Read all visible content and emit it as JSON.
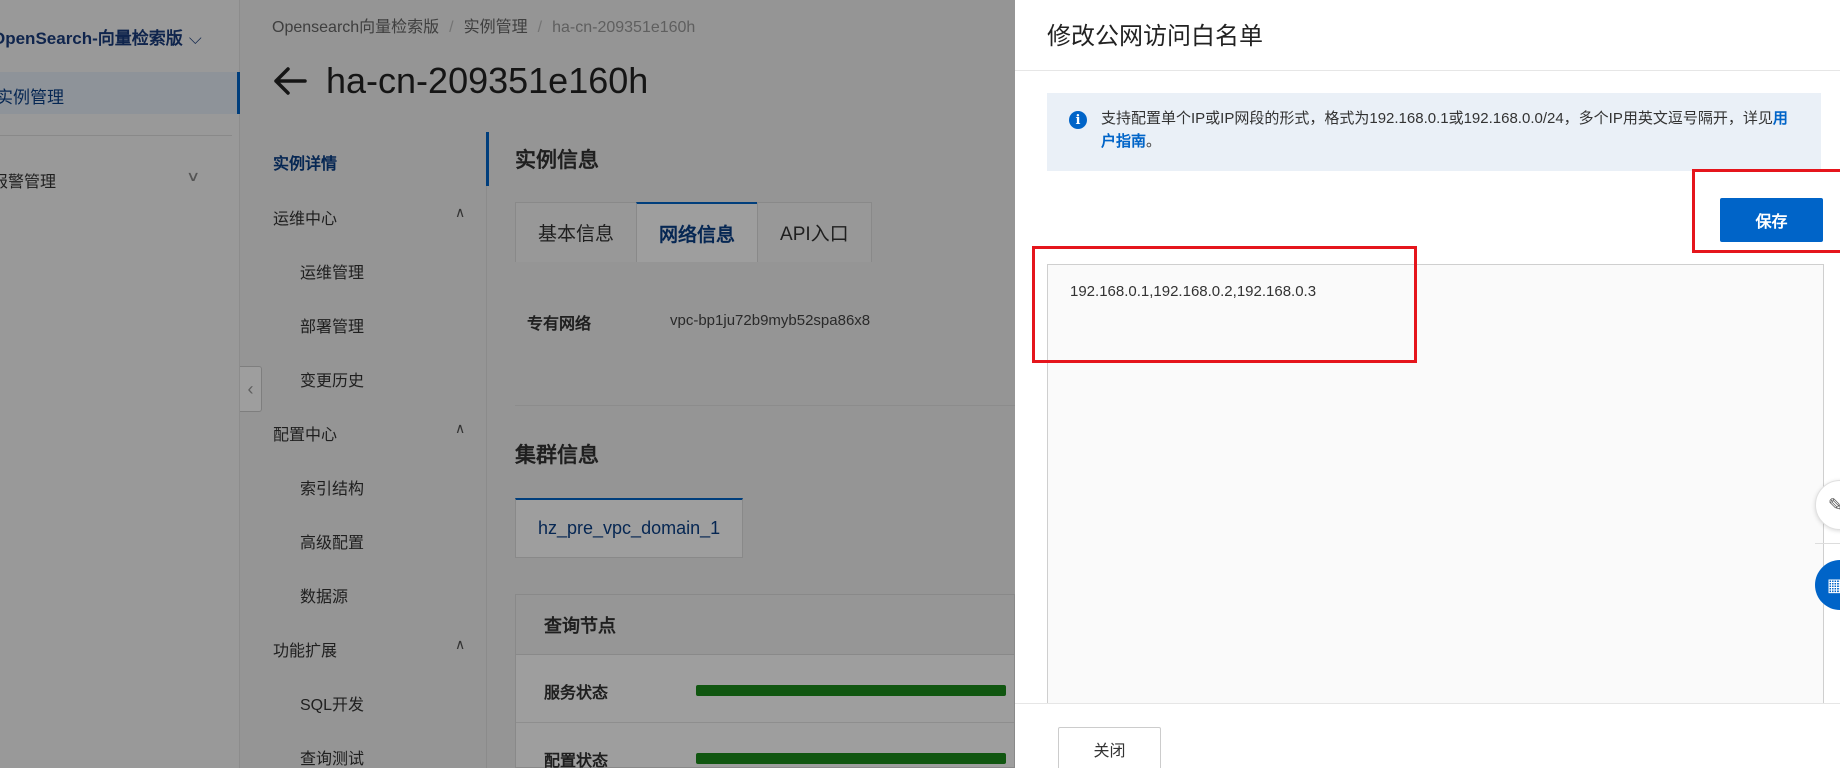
{
  "nav": {
    "product_title": "OpenSearch-向量检索版",
    "active_item": "实例管理",
    "alarm_item": "报警管理"
  },
  "breadcrumb": [
    "Opensearch向量检索版",
    "实例管理",
    "ha-cn-209351e160h"
  ],
  "page": {
    "title": "ha-cn-209351e160h"
  },
  "submenu": {
    "detail": "实例详情",
    "ops_center": "运维中心",
    "ops_manage": "运维管理",
    "deploy_manage": "部署管理",
    "change_history": "变更历史",
    "config_center": "配置中心",
    "index_schema": "索引结构",
    "advanced_config": "高级配置",
    "data_source": "数据源",
    "extensions": "功能扩展",
    "sql_dev": "SQL开发",
    "query_test": "查询测试"
  },
  "instance_info": {
    "section_title": "实例信息",
    "tabs": [
      "基本信息",
      "网络信息",
      "API入口"
    ],
    "vpc_label": "专有网络",
    "vpc_value": "vpc-bp1ju72b9myb52spa86x8"
  },
  "cluster_info": {
    "section_title": "集群信息",
    "domain_tab": "hz_pre_vpc_domain_1",
    "node_header": "查询节点",
    "service_status": "服务状态",
    "config_status": "配置状态",
    "service_progress": 1.0,
    "config_progress": 1.0,
    "status_color": "#1a8c1a"
  },
  "drawer": {
    "title": "修改公网访问白名单",
    "notice_text": "支持配置单个IP或IP网段的形式，格式为192.168.0.1或192.168.0.0/24，多个IP用英文逗号隔开，详见",
    "notice_link": "用户指南",
    "notice_end": "。",
    "save_label": "保存",
    "whitelist_value": "192.168.0.1,192.168.0.2,192.168.0.3",
    "close_label": "关闭"
  },
  "colors": {
    "accent": "#0064c8",
    "highlight": "#e5151c",
    "success": "#1a8c1a"
  }
}
